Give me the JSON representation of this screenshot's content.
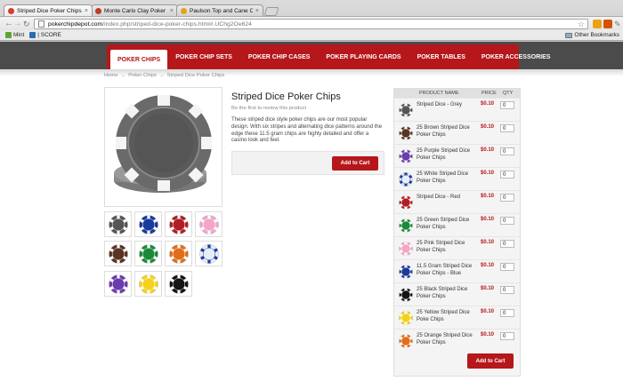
{
  "browser": {
    "tabs": [
      {
        "title": "Striped Dice Poker Chips - P",
        "favicon_color": "#d93a2b"
      },
      {
        "title": "Monte Carlo Clay Poker Chip",
        "favicon_color": "#c0392b"
      },
      {
        "title": "Paulson Top and Cane Clay P",
        "favicon_color": "#e8a317"
      }
    ],
    "url_domain": "pokerchipdepot.com",
    "url_path": "/index.php/striped-dice-poker-chips.html#.UChg2Oe624",
    "bookmarks": [
      {
        "label": "Mint",
        "color": "#5aa732"
      },
      {
        "label": "| SCORE",
        "color": "#2b6cb0"
      }
    ],
    "other_bookmarks": "Other Bookmarks"
  },
  "nav": {
    "items": [
      "POKER CHIPS",
      "POKER CHIP SETS",
      "POKER CHIP CASES",
      "POKER PLAYING CARDS",
      "POKER TABLES",
      "POKER ACCESSORIES"
    ]
  },
  "breadcrumb": [
    "Home",
    "→",
    "Poker Chips",
    "→",
    "Striped Dice Poker Chips"
  ],
  "product": {
    "title": "Striped Dice Poker Chips",
    "review_text": "Be the first to review this product",
    "description": "These striped dice style poker chips are our most popular design. With six stripes and alternating dice patterns around the edge these 11.5 gram chips are highly detailed and offer a casino look and feel.",
    "add_to_cart": "Add to Cart",
    "thumb_colors": [
      "#555555",
      "#1a3a9c",
      "#b21d25",
      "#f2a6c8",
      "#5a3324",
      "#1a8a3a",
      "#e06e1a",
      "#e8eef8",
      "#6a3cae",
      "#f4d21c",
      "#151515"
    ]
  },
  "table": {
    "headers": {
      "name": "PRODUCT NAME",
      "price": "PRICE",
      "qty": "QTY"
    },
    "add_to_cart": "Add to Cart",
    "rows": [
      {
        "name": "Striped Dice - Grey",
        "price": "$0.10",
        "qty": "0",
        "color": "#555555"
      },
      {
        "name": "25 Brown Striped Dice Poker Chips",
        "price": "$0.10",
        "qty": "0",
        "color": "#5a3324"
      },
      {
        "name": "25 Purple Striped Dice Poker Chips",
        "price": "$0.10",
        "qty": "0",
        "color": "#6a3cae"
      },
      {
        "name": "25 White Striped Dice Poker Chips",
        "price": "$0.10",
        "qty": "0",
        "color": "#e8eef8"
      },
      {
        "name": "Striped Dice - Red",
        "price": "$0.10",
        "qty": "0",
        "color": "#b21d25"
      },
      {
        "name": "25 Green Striped Dice Poker Chips",
        "price": "$0.10",
        "qty": "0",
        "color": "#1a8a3a"
      },
      {
        "name": "25 Pink Striped Dice Poker Chips",
        "price": "$0.10",
        "qty": "0",
        "color": "#f2a6c8"
      },
      {
        "name": "11.5 Gram Striped Dice Poker Chips - Blue",
        "price": "$0.10",
        "qty": "0",
        "color": "#1a3a9c"
      },
      {
        "name": "25 Black Striped Dice Poker Chips",
        "price": "$0.10",
        "qty": "0",
        "color": "#151515"
      },
      {
        "name": "25 Yellow Striped Dice Poke Chips",
        "price": "$0.10",
        "qty": "0",
        "color": "#f4d21c"
      },
      {
        "name": "25 Orange Striped Dice Poker Chips",
        "price": "$0.10",
        "qty": "0",
        "color": "#e06e1a"
      }
    ]
  }
}
